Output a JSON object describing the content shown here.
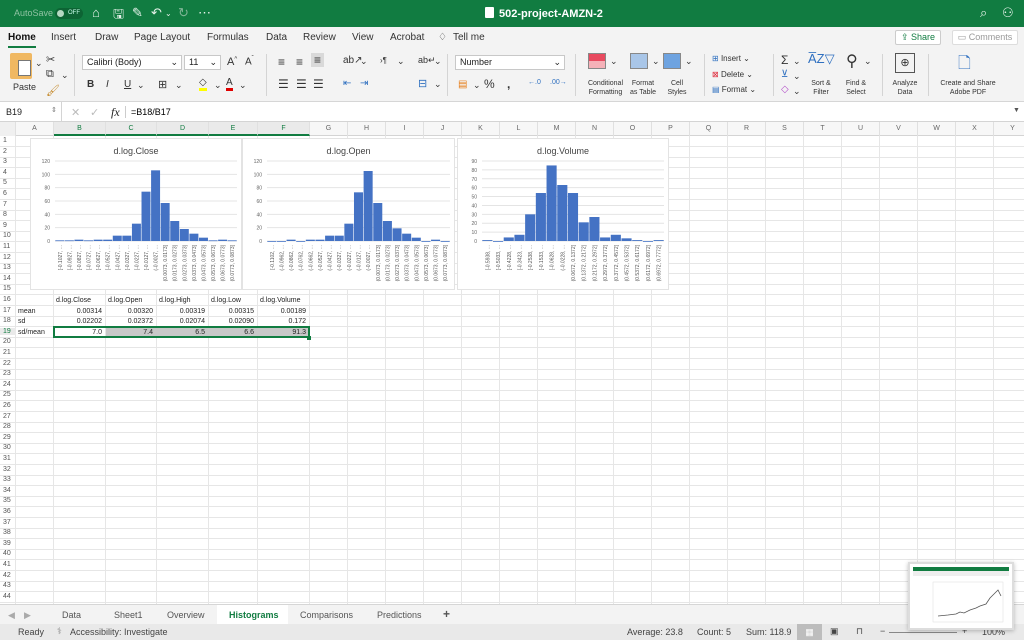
{
  "titlebar": {
    "autosave_label": "AutoSave",
    "autosave_state": "OFF",
    "document_title": "502-project-AMZN-2",
    "icons": [
      "home-icon",
      "save-icon",
      "save-as-icon",
      "undo-icon",
      "redo-icon",
      "more-icon",
      "search-icon",
      "account-icon"
    ]
  },
  "ribbon_tabs": [
    "Home",
    "Insert",
    "Draw",
    "Page Layout",
    "Formulas",
    "Data",
    "Review",
    "View",
    "Acrobat",
    "Tell me"
  ],
  "active_ribbon_tab": "Home",
  "share_label": "Share",
  "comments_label": "Comments",
  "ribbon": {
    "paste_label": "Paste",
    "font_name": "Calibri (Body)",
    "font_size": "11",
    "number_format": "Number",
    "conditional_formatting": "Conditional Formatting",
    "conditional_formatting_l1": "Conditional",
    "conditional_formatting_l2": "Formatting",
    "format_as_table_l1": "Format",
    "format_as_table_l2": "as Table",
    "cell_styles_l1": "Cell",
    "cell_styles_l2": "Styles",
    "insert_label": "Insert",
    "delete_label": "Delete",
    "format_label": "Format",
    "sort_filter_l1": "Sort &",
    "sort_filter_l2": "Filter",
    "find_select_l1": "Find &",
    "find_select_l2": "Select",
    "analyze_l1": "Analyze",
    "analyze_l2": "Data",
    "adobe_l1": "Create and Share",
    "adobe_l2": "Adobe PDF",
    "colors": {
      "highlight": "#ffff00",
      "font": "#e00000"
    }
  },
  "formula_bar": {
    "name_box": "B19",
    "fx": "fx",
    "formula": "=B18/B17"
  },
  "columns": [
    "A",
    "B",
    "C",
    "D",
    "E",
    "F",
    "G",
    "H",
    "I",
    "J",
    "K",
    "L",
    "M",
    "N",
    "O",
    "P",
    "Q",
    "R",
    "S",
    "T",
    "U",
    "V",
    "W",
    "X",
    "Y"
  ],
  "selected_columns": [
    "B",
    "C",
    "D",
    "E",
    "F"
  ],
  "rows": [
    "1",
    "2",
    "3",
    "4",
    "5",
    "6",
    "7",
    "8",
    "9",
    "10",
    "11",
    "12",
    "13",
    "14",
    "15",
    "16",
    "17",
    "18",
    "19",
    "20",
    "21",
    "22",
    "23",
    "24",
    "25",
    "26",
    "27",
    "28",
    "29",
    "30",
    "31",
    "32",
    "33",
    "34",
    "35",
    "36",
    "37",
    "38",
    "39",
    "40",
    "41",
    "42",
    "43",
    "44"
  ],
  "stats_table": {
    "headers": [
      "d.log.Close",
      "d.log.Open",
      "d.log.High",
      "d.log.Low",
      "d.log.Volume"
    ],
    "rows": [
      {
        "label": "mean",
        "values": [
          "0.00314",
          "0.00320",
          "0.00319",
          "0.00315",
          "0.00189"
        ]
      },
      {
        "label": "sd",
        "values": [
          "0.02202",
          "0.02372",
          "0.02074",
          "0.02090",
          "0.172"
        ]
      },
      {
        "label": "sd/mean",
        "values": [
          "7.0",
          "7.4",
          "6.5",
          "6.6",
          "91.3"
        ]
      }
    ]
  },
  "chart_data": [
    {
      "type": "bar",
      "title": "d.log.Close",
      "ylim": [
        0,
        120
      ],
      "yticks": [
        0,
        20,
        40,
        60,
        80,
        100,
        120
      ],
      "grid": true,
      "categories": [
        "[-0.1027, ...",
        "[-0.0927, ...",
        "[-0.0827, ...",
        "[-0.0727, ...",
        "[-0.0627, ...",
        "[-0.0527, ...",
        "[-0.0427, ...",
        "[-0.0327, ...",
        "[-0.0227, ...",
        "[-0.0127, ...",
        "(-0.0027, ...",
        "(0.0073, 0.0173]",
        "(0.0173, 0.0273]",
        "(0.0273, 0.0373]",
        "(0.0373, 0.0473]",
        "(0.0473, 0.0573]",
        "(0.0573, 0.0673]",
        "(0.0673, 0.0773]",
        "(0.0773, 0.0873]"
      ],
      "values": [
        1,
        1,
        2,
        1,
        2,
        2,
        8,
        8,
        26,
        74,
        106,
        57,
        30,
        18,
        11,
        5,
        1,
        2,
        1
      ]
    },
    {
      "type": "bar",
      "title": "d.log.Open",
      "ylim": [
        0,
        120
      ],
      "yticks": [
        0,
        20,
        40,
        60,
        80,
        100,
        120
      ],
      "grid": true,
      "categories": [
        "[-0.1102, ...",
        "(-0.0962, ...",
        "(-0.0862, ...",
        "(-0.0762, ...",
        "(-0.0662, ...",
        "(-0.0527, ...",
        "(-0.0427, ...",
        "(-0.0327, ...",
        "(-0.0227, ...",
        "(-0.0127, ...",
        "(-0.0027, ...",
        "(0.0073, 0.0173]",
        "(0.0173, 0.0273]",
        "(0.0273, 0.0373]",
        "(0.0373, 0.0473]",
        "(0.0473, 0.0573]",
        "(0.0573, 0.0673]",
        "(0.0673, 0.0773]",
        "(0.0773, 0.0873]"
      ],
      "values": [
        0,
        0,
        2,
        0,
        2,
        2,
        8,
        8,
        26,
        73,
        105,
        57,
        30,
        19,
        11,
        5,
        0,
        2,
        0
      ]
    },
    {
      "type": "bar",
      "title": "d.log.Volume",
      "ylim": [
        0,
        90
      ],
      "yticks": [
        0,
        10,
        20,
        30,
        40,
        50,
        60,
        70,
        80,
        90
      ],
      "grid": true,
      "categories": [
        "[-0.5938, ...",
        "[-0.5033, ...",
        "[-0.4228, ...",
        "[-0.3423, ...",
        "[-0.2538, ...",
        "[-0.1533, ...",
        "[-0.0628, ...",
        "(-0.0228, ...",
        "(0.0672, 0.1372]",
        "(0.1372, 0.2172]",
        "(0.2172, 0.2972]",
        "(0.2972, 0.3772]",
        "(0.3772, 0.4572]",
        "(0.4572, 0.5372]",
        "(0.5372, 0.6172]",
        "(0.6172, 0.6972]",
        "(0.6972, 0.7772]"
      ],
      "values": [
        1,
        0,
        4,
        7,
        30,
        54,
        85,
        63,
        54,
        21,
        27,
        4,
        7,
        3,
        1,
        0,
        1
      ]
    }
  ],
  "sheet_tabs": [
    "Data",
    "Sheet1",
    "Overview",
    "Histograms",
    "Comparisons",
    "Predictions"
  ],
  "active_sheet": "Histograms",
  "add_sheet": "+",
  "status": {
    "ready": "Ready",
    "accessibility": "Accessibility: Investigate",
    "average": "Average: 23.8",
    "count": "Count: 5",
    "sum": "Sum: 118.9",
    "zoom": "100%"
  },
  "chart_color": "#4472c4"
}
